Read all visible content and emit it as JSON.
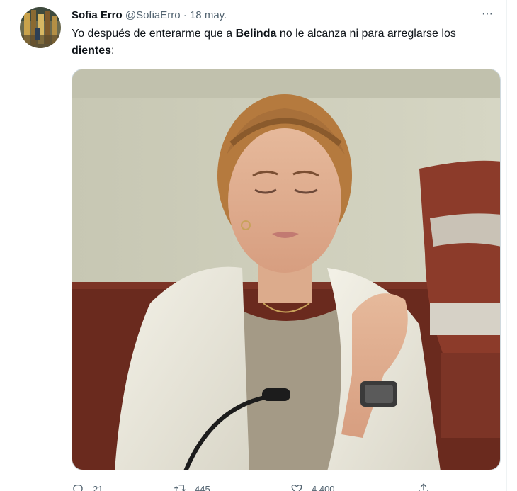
{
  "tweet": {
    "author_name": "Sofia Erro",
    "author_handle": "@SofiaErro",
    "separator": "·",
    "date": "18 may.",
    "more_label": "···",
    "text_part1": "Yo después de enterarme que a ",
    "text_bold1": "Belinda",
    "text_part2": " no le alcanza ni para arreglarse los ",
    "text_bold2": "dientes",
    "text_part3": ":"
  },
  "actions": {
    "reply_count": "21",
    "retweet_count": "445",
    "like_count": "4,400"
  },
  "icons": {
    "avatar": "avatar-image",
    "more": "more-options-icon",
    "reply": "reply-icon",
    "retweet": "retweet-icon",
    "like": "heart-icon",
    "share": "share-icon"
  },
  "colors": {
    "text": "#0f1419",
    "secondary": "#536471",
    "border": "#cfd9de"
  }
}
